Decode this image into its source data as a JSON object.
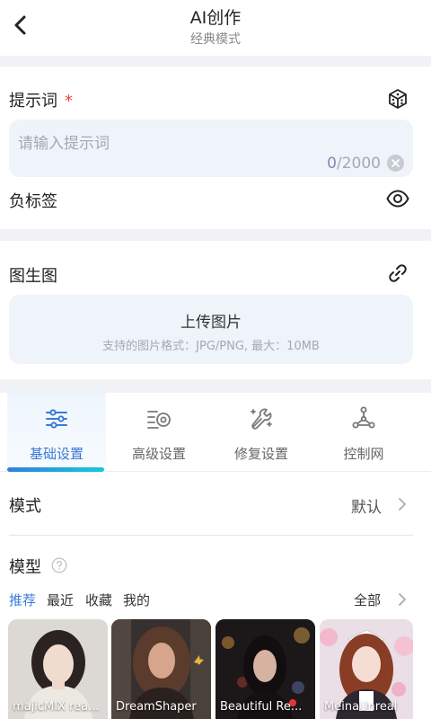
{
  "header": {
    "title": "AI创作",
    "subtitle": "经典模式"
  },
  "prompt": {
    "label": "提示词",
    "required_mark": "*",
    "placeholder": "请输入提示词",
    "count_current": "0",
    "count_max": "/2000"
  },
  "negative": {
    "label": "负标签"
  },
  "img2img": {
    "label": "图生图",
    "upload_title": "上传图片",
    "upload_hint": "支持的图片格式：JPG/PNG, 最大：10MB"
  },
  "tabs": [
    {
      "label": "基础设置",
      "icon": "sliders-icon",
      "active": true
    },
    {
      "label": "高级设置",
      "icon": "advanced-settings-icon",
      "active": false
    },
    {
      "label": "修复设置",
      "icon": "repair-wrench-icon",
      "active": false
    },
    {
      "label": "控制网",
      "icon": "controlnet-icon",
      "active": false
    }
  ],
  "mode": {
    "label": "模式",
    "value": "默认"
  },
  "model": {
    "label": "模型",
    "filters": [
      "推荐",
      "最近",
      "收藏",
      "我的"
    ],
    "active_filter": "推荐",
    "all_label": "全部",
    "cards": [
      {
        "name": "majicMIX rea..."
      },
      {
        "name": "DreamShaper"
      },
      {
        "name": "Beautiful Re..."
      },
      {
        "name": "MeinaUnreal"
      }
    ]
  },
  "colors": {
    "accent": "#3a78d8",
    "required": "#e8453c",
    "field_bg": "#eff3fa",
    "section_gap": "#f1f2f5"
  }
}
